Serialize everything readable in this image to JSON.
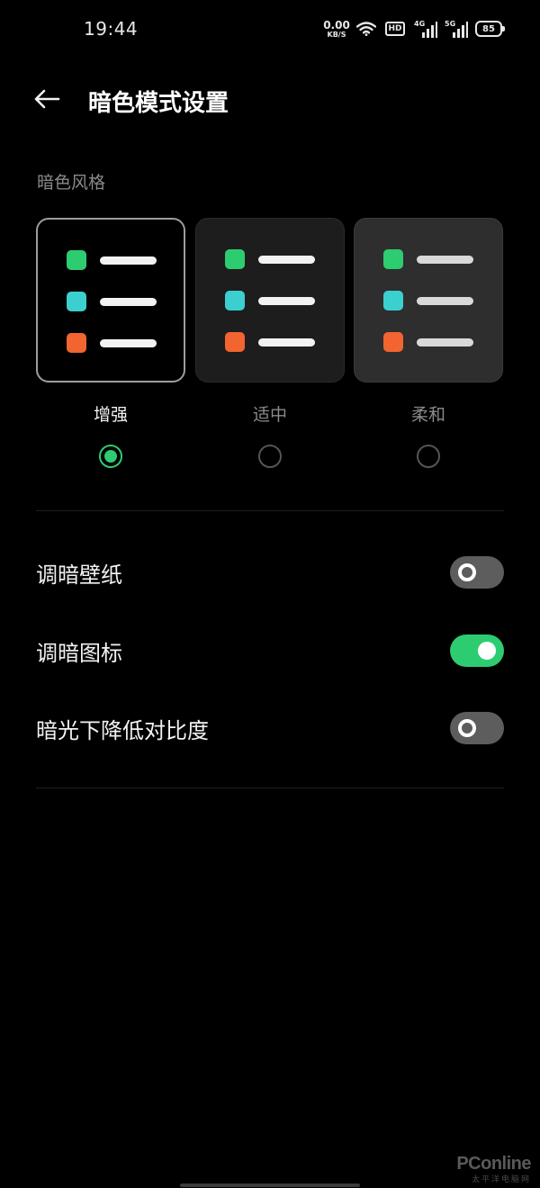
{
  "status_bar": {
    "time": "19:44",
    "net_speed_value": "0.00",
    "net_speed_unit": "KB/S",
    "hd_label": "HD",
    "signal1_label": "4G",
    "signal2_label": "5G",
    "battery_level": "85"
  },
  "header": {
    "title": "暗色模式设置"
  },
  "dark_style": {
    "section_label": "暗色风格",
    "options": [
      {
        "label": "增强",
        "selected": true
      },
      {
        "label": "适中",
        "selected": false
      },
      {
        "label": "柔和",
        "selected": false
      }
    ],
    "preview_colors": {
      "green": "#2ecc71",
      "cyan": "#3ccfcf",
      "orange": "#f26430"
    }
  },
  "settings": [
    {
      "label": "调暗壁纸",
      "enabled": false
    },
    {
      "label": "调暗图标",
      "enabled": true
    },
    {
      "label": "暗光下降低对比度",
      "enabled": false
    }
  ],
  "colors": {
    "accent": "#2ecc71",
    "background": "#000000",
    "toggle_off": "#5d5d5d"
  },
  "watermark": {
    "brand": "PConline",
    "sub": "太平洋电脑网"
  }
}
